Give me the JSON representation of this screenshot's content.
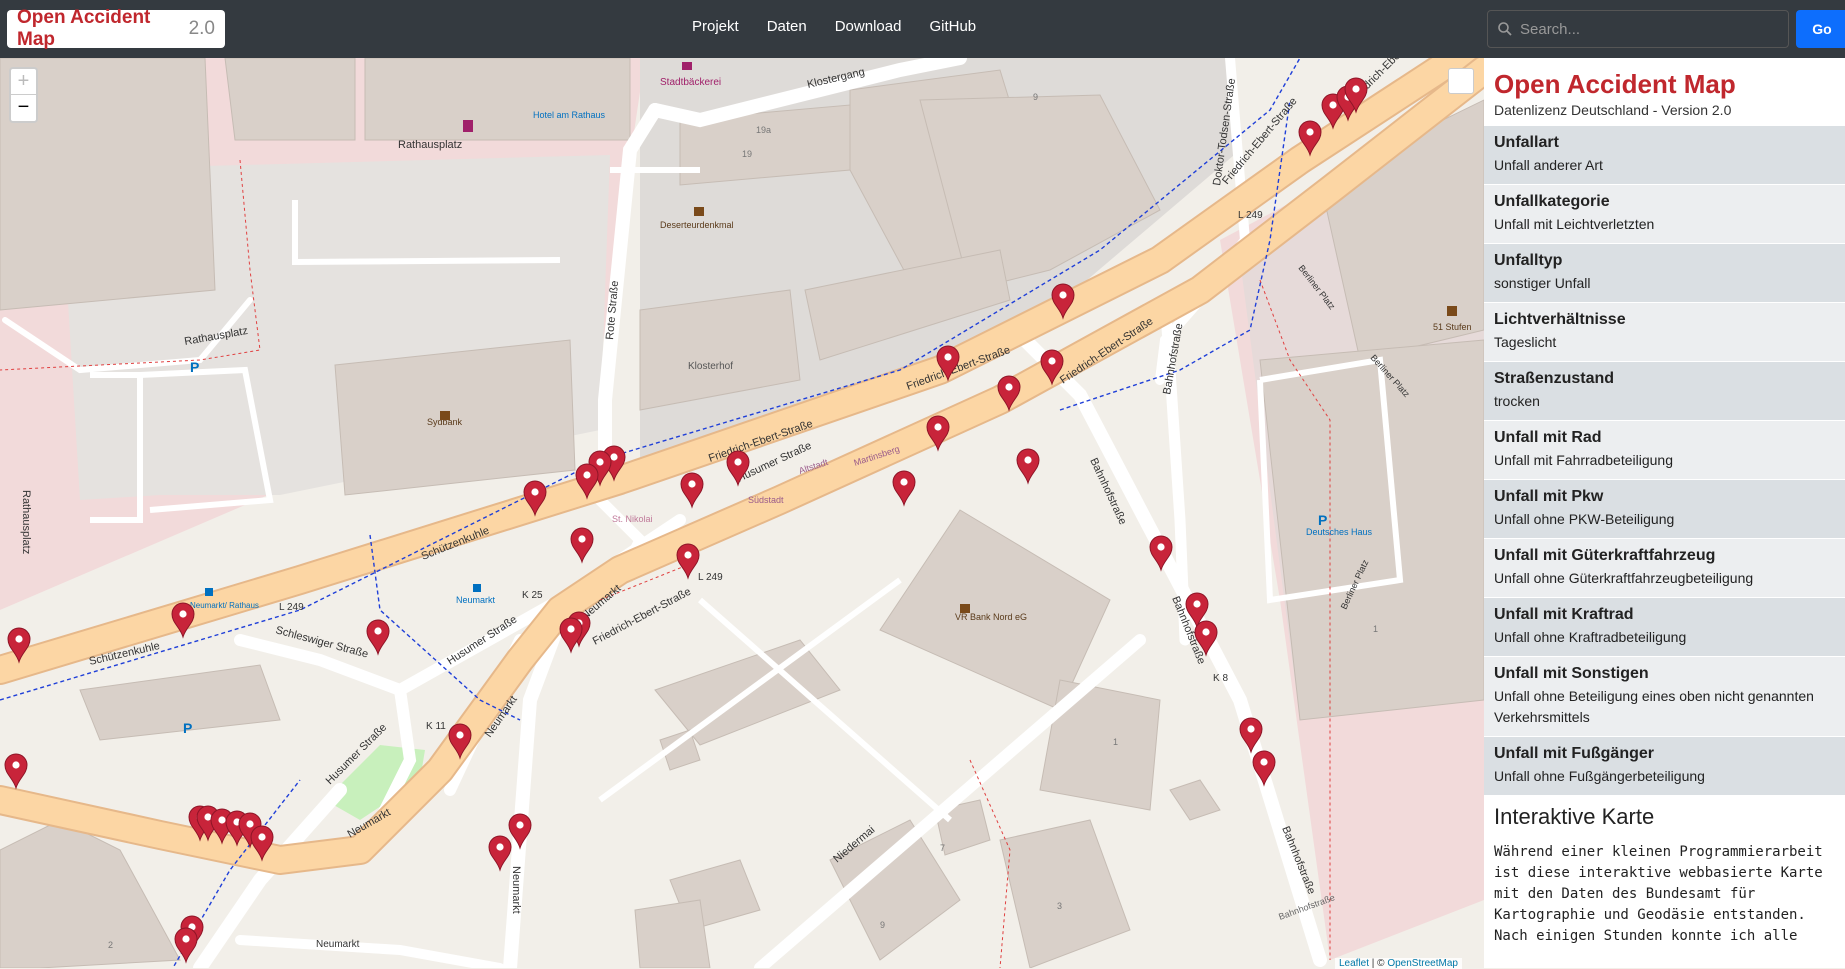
{
  "navbar": {
    "brand_name": "Open Accident Map",
    "brand_version": "2.0",
    "links": [
      "Projekt",
      "Daten",
      "Download",
      "GitHub"
    ],
    "search_placeholder": "Search...",
    "go_label": "Go"
  },
  "map": {
    "zoom_in": "+",
    "zoom_out": "−",
    "attribution_leaflet": "Leaflet",
    "attribution_sep": " | © ",
    "attribution_osm": "OpenStreetMap",
    "labels": {
      "klostergang": "Klostergang",
      "stadtbaeckerei": "Stadtbäckerei",
      "hotel": "Hotel am Rathaus",
      "rathausplatz1": "Rathausplatz",
      "rathausplatz2": "Rathausplatz",
      "rathausplatz3": "Rathausplatz",
      "rote_strasse": "Rote Straße",
      "deserteurdenkmal": "Deserteurdenkmal",
      "klosterhof": "Klosterhof",
      "sydbank": "Sydbank",
      "friedrich1": "Friedrich-Ebert-Straße",
      "friedrich2": "Friedrich-Ebert-Straße",
      "friedrich3": "Friedrich-Ebert-Straße",
      "friedrich4": "Friedrich-Ebert-Straße",
      "friedrich5": "Friedrich-Ebert-Straße",
      "friedrich6": "Friedrich-Ebert-Straße",
      "husumer1": "Husumer Straße",
      "husumer2": "Husumer Straße",
      "husumer3": "Husumer Straße",
      "altstadt": "Altstadt",
      "martinsberg": "Martinsberg",
      "suedstadt": "Südstadt",
      "st_nikolai": "St. Nikolai",
      "schuetzenkuhle1": "Schützenkuhle",
      "schuetzenkuhle2": "Schützenkuhle",
      "schleswiger": "Schleswiger Straße",
      "neumarkt_stop": "Neumarkt/ Rathaus",
      "neumarkt_poi": "Neumarkt",
      "neumarkt1": "Neumarkt",
      "neumarkt2": "Neumarkt",
      "neumarkt3": "Neumarkt",
      "neumarkt4": "Neumarkt",
      "neumarkt5": "Neumarkt",
      "l249_1": "L 249",
      "l249_2": "L 249",
      "l249_3": "L 249",
      "k25": "K 25",
      "k11": "K 11",
      "k8": "K 8",
      "vr_bank": "VR Bank Nord eG",
      "niedermai": "Niedermai",
      "bahnhofstrasse1": "Bahnhofstraße",
      "bahnhofstrasse2": "Bahnhofstraße",
      "bahnhofstrasse3": "Bahnhofstraße",
      "bahnhofstrasse4": "Bahnhofstraße",
      "bahnhofstrasse5": "Bahnhofstraße",
      "doktor": "Doktor-Todsen-Straße",
      "berliner1": "Berliner Platz",
      "berliner2": "Berliner Platz",
      "berliner3": "Berliner Platz",
      "stufen": "51 Stufen",
      "deutsches_haus": "Deutsches Haus",
      "n9": "9",
      "n19a": "19a",
      "n19": "19",
      "n1a": "1",
      "n1b": "1",
      "n2": "2",
      "n3": "3",
      "n7": "7",
      "n9b": "9"
    }
  },
  "panel": {
    "title": "Open Accident Map",
    "subtitle": "Datenlizenz Deutschland - Version 2.0",
    "attributes": [
      {
        "key": "Unfallart",
        "value": "Unfall anderer Art"
      },
      {
        "key": "Unfallkategorie",
        "value": "Unfall mit Leichtverletzten"
      },
      {
        "key": "Unfalltyp",
        "value": "sonstiger Unfall"
      },
      {
        "key": "Lichtverhältnisse",
        "value": "Tageslicht"
      },
      {
        "key": "Straßenzustand",
        "value": "trocken"
      },
      {
        "key": "Unfall mit Rad",
        "value": "Unfall mit Fahrradbeteiligung"
      },
      {
        "key": "Unfall mit Pkw",
        "value": "Unfall ohne PKW-Beteiligung"
      },
      {
        "key": "Unfall mit Güterkraftfahrzeug",
        "value": "Unfall ohne Güterkraftfahrzeugbeteiligung"
      },
      {
        "key": "Unfall mit Kraftrad",
        "value": "Unfall ohne Kraftradbeteiligung"
      },
      {
        "key": "Unfall mit Sonstigen",
        "value": "Unfall ohne Beteiligung eines oben nicht genannten Verkehrsmittels"
      },
      {
        "key": "Unfall mit Fußgänger",
        "value": "Unfall ohne Fußgängerbeteiligung"
      }
    ],
    "intro_heading": "Interaktive Karte",
    "intro_text": "Während einer kleinen Programmierarbeit ist diese interaktive webbasierte Karte mit den Daten des Bundesamt für Kartographie und Geodäsie entstanden. Nach einigen Stunden konnte ich alle"
  },
  "colors": {
    "navbar": "#343a40",
    "brand_red": "#c0272d",
    "go_button": "#0d6efd",
    "marker": "#c8243a",
    "main_road": "#fcd6a4"
  }
}
